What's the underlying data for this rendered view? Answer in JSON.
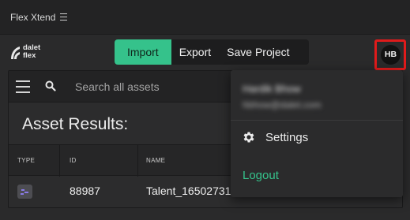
{
  "app": {
    "title": "Flex Xtend"
  },
  "header": {
    "logo_line1": "dalet",
    "logo_line2": "flex",
    "tabs": [
      {
        "label": "Import",
        "active": true
      },
      {
        "label": "Export",
        "active": false
      },
      {
        "label": "Save Project",
        "active": false
      }
    ],
    "avatar_initials": "HB"
  },
  "toolbar": {
    "search_placeholder": "Search all assets"
  },
  "results": {
    "title": "Asset Results:",
    "columns": [
      "TYPE",
      "ID",
      "NAME"
    ],
    "rows": [
      {
        "id": "88987",
        "name": "Talent_16502731"
      }
    ]
  },
  "user_menu": {
    "name": "Hardik Bhow",
    "email": "hbhow@dalet.com",
    "settings_label": "Settings",
    "logout_label": "Logout"
  },
  "colors": {
    "accent": "#35c28b",
    "highlight": "#e01b1b"
  }
}
